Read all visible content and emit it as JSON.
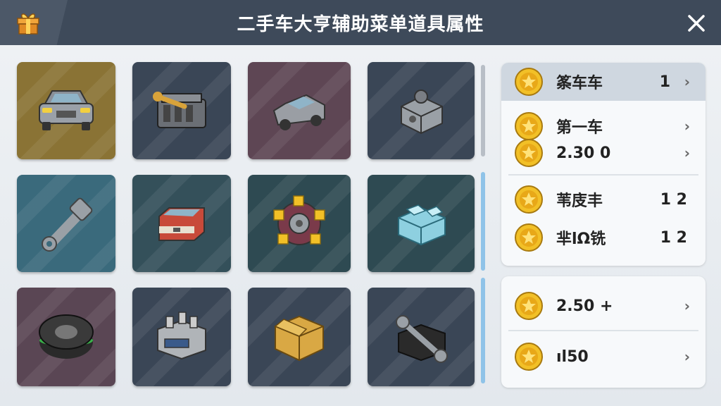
{
  "header": {
    "title": "二手车大亨辅助菜单道具属性",
    "close_glyph": "✕",
    "gift_icon": "gift-icon"
  },
  "grid": {
    "items": [
      {
        "name": "car",
        "icon": "car-icon",
        "bg": "#8a7335"
      },
      {
        "name": "engine-wrench",
        "icon": "engine-icon",
        "bg": "#3a4656"
      },
      {
        "name": "jeep",
        "icon": "jeep-icon",
        "bg": "#5e4654"
      },
      {
        "name": "metal-block",
        "icon": "block-icon",
        "bg": "#3a4656"
      },
      {
        "name": "key-tool",
        "icon": "key-icon",
        "bg": "#3a6a7c"
      },
      {
        "name": "red-toolbox",
        "icon": "toolbox-icon",
        "bg": "#34505a"
      },
      {
        "name": "gear-ring",
        "icon": "gear-icon",
        "bg": "#2e4a52"
      },
      {
        "name": "ice-block",
        "icon": "ice-icon",
        "bg": "#2e4a52"
      },
      {
        "name": "tire",
        "icon": "tire-icon",
        "bg": "#5a4654"
      },
      {
        "name": "machine-part",
        "icon": "machine-icon",
        "bg": "#3a4656"
      },
      {
        "name": "cardboard-box",
        "icon": "box-icon",
        "bg": "#3a4656"
      },
      {
        "name": "wrench-part",
        "icon": "wrench-icon",
        "bg": "#3a4656"
      }
    ]
  },
  "panel_top": {
    "rows": [
      {
        "label": "筿车车",
        "value": "1",
        "chevron": "›",
        "selected": true
      },
      {
        "label": "第一车",
        "value": "",
        "chevron": "›"
      },
      {
        "label": "2.30 0",
        "value": "",
        "chevron": "›"
      }
    ]
  },
  "panel_mid": {
    "rows": [
      {
        "label": "苇庋丰",
        "value": "1 2"
      },
      {
        "label": "芈lΩ铣",
        "value": "1 2"
      }
    ]
  },
  "panel_bot": {
    "rows": [
      {
        "label": "2.50 +",
        "value": "",
        "chevron": "›"
      },
      {
        "label": "ıl50",
        "value": "",
        "chevron": "›"
      }
    ]
  },
  "colors": {
    "titlebar": "#3e4a5a",
    "coin": "#f2c027",
    "selected_row": "#cfd7e0",
    "scroll_active": "#8fc3e8"
  }
}
